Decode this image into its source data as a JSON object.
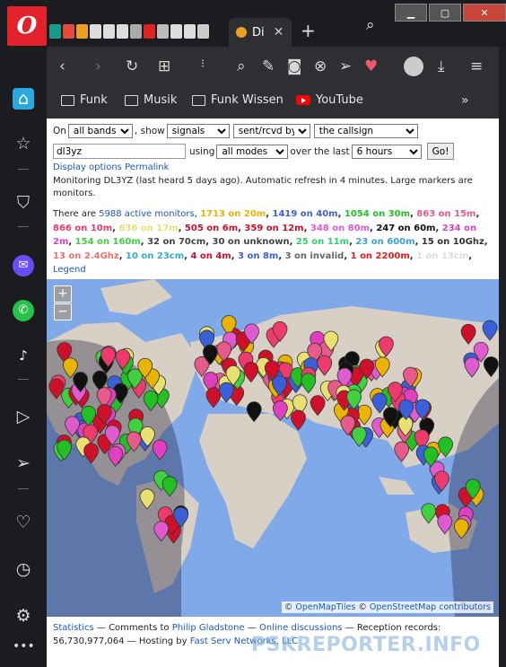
{
  "browser": {
    "active_tab": {
      "title": "Di"
    },
    "bookmarks": [
      {
        "label": "Funk",
        "icon": "folder-icon"
      },
      {
        "label": "Musik",
        "icon": "folder-icon"
      },
      {
        "label": "Funk Wissen",
        "icon": "folder-icon"
      },
      {
        "label": "YouTube",
        "icon": "youtube-icon"
      }
    ],
    "bookmarks_more": "»"
  },
  "controls": {
    "on_label": "On",
    "band_value": "all bands",
    "show_label": ", show",
    "show_value": "signals",
    "sentrcvd_value": "sent/rcvd by",
    "callsign_select_value": "the callsign",
    "callsign_input": "dl3yz",
    "using_label": "using",
    "mode_value": "all modes",
    "over_label": "over the last",
    "time_value": "6 hours",
    "go_label": "Go!",
    "display_options": "Display options",
    "permalink": "Permalink"
  },
  "monitoring": "Monitoring DL3YZ (last heard 5 days ago). Automatic refresh in 4 minutes. Large markers are monitors.",
  "legend": {
    "prefix": "There are ",
    "active_monitors": "5988 active monitors",
    "items": [
      {
        "text": "1713 on 20m",
        "color": "#e8b400"
      },
      {
        "text": "1419 on 40m",
        "color": "#3a5fd9"
      },
      {
        "text": "1054 on 30m",
        "color": "#22c022"
      },
      {
        "text": "863 on 15m",
        "color": "#e85a8a"
      },
      {
        "text": "866 on 10m",
        "color": "#ee3a6c"
      },
      {
        "text": "636 on 17m",
        "color": "#e8e070"
      },
      {
        "text": "505 on 6m",
        "color": "#d0102a"
      },
      {
        "text": "359 on 12m",
        "color": "#d0102a"
      },
      {
        "text": "348 on 80m",
        "color": "#e05ad0"
      },
      {
        "text": "247 on 60m",
        "color": "#111111"
      },
      {
        "text": "234 on 2m",
        "color": "#e040c0"
      },
      {
        "text": "154 on 160m",
        "color": "#40d040"
      },
      {
        "text": "32 on 70cm",
        "color": "#444444"
      },
      {
        "text": "30 on unknown",
        "color": "#444444"
      },
      {
        "text": "25 on 11m",
        "color": "#30d070"
      },
      {
        "text": "23 on 600m",
        "color": "#3aa0e0"
      },
      {
        "text": "15 on 10Ghz",
        "color": "#333333"
      },
      {
        "text": "13 on 2.4Ghz",
        "color": "#f07070"
      },
      {
        "text": "10 on 23cm",
        "color": "#30b0d0"
      },
      {
        "text": "4 on 4m",
        "color": "#d0102a"
      },
      {
        "text": "3 on 8m",
        "color": "#3a5fd9"
      },
      {
        "text": "3 on invalid",
        "color": "#666666"
      },
      {
        "text": "1 on 2200m",
        "color": "#e02020"
      },
      {
        "text": "1 on 13cm",
        "color": "#dddddd"
      }
    ],
    "legend_link": "Legend"
  },
  "map": {
    "zoom_in": "+",
    "zoom_out": "−",
    "attribution_1": "OpenMapTiles",
    "attribution_2": "OpenStreetMap contributors",
    "copyright": "©"
  },
  "footer": {
    "statistics": "Statistics",
    "comments": " — Comments to ",
    "author": "Philip Gladstone",
    "sep": " — ",
    "online": "Online discussions",
    "records": " — Reception records: 56,730,977,064 — Hosting by ",
    "host": "Fast Serv Networks, LLC"
  },
  "watermark": "PSKREPORTER.INFO"
}
